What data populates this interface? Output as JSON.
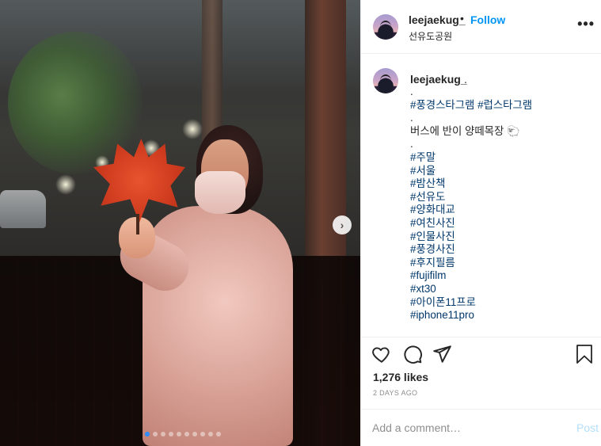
{
  "post": {
    "username": "leejaekug_",
    "separator": "•",
    "follow_label": "Follow",
    "location": "선유도공원",
    "more_label": "•••",
    "next_label": "›",
    "carousel": {
      "count": 10,
      "active_index": 0
    }
  },
  "caption": {
    "username": "leejaekug_",
    "after_user": ".",
    "lines": [
      {
        "text": ".",
        "tag": false
      },
      {
        "text": "#풍경스타그램 #럽스타그램",
        "tag": true
      },
      {
        "text": ".",
        "tag": false
      },
      {
        "text": "버스에 반이 양떼목장 🐑",
        "tag": false
      },
      {
        "text": ".",
        "tag": false
      },
      {
        "text": "#주말",
        "tag": true
      },
      {
        "text": "#서울",
        "tag": true
      },
      {
        "text": "#밤산책",
        "tag": true
      },
      {
        "text": "#선유도",
        "tag": true
      },
      {
        "text": "#양화대교",
        "tag": true
      },
      {
        "text": "#여친사진",
        "tag": true
      },
      {
        "text": "#인물사진",
        "tag": true
      },
      {
        "text": "#풍경사진",
        "tag": true
      },
      {
        "text": "#후지필름",
        "tag": true
      },
      {
        "text": "#fujifilm",
        "tag": true
      },
      {
        "text": "#xt30",
        "tag": true
      },
      {
        "text": "#아이폰11프로",
        "tag": true
      },
      {
        "text": "#iphone11pro",
        "tag": true
      }
    ]
  },
  "actions": {
    "likes": "1,276 likes",
    "date": "2 DAYS AGO"
  },
  "comment_box": {
    "placeholder": "Add a comment…",
    "post_label": "Post"
  },
  "colors": {
    "link": "#0095f6",
    "hashtag": "#00376b",
    "muted": "#8e8e8e"
  }
}
